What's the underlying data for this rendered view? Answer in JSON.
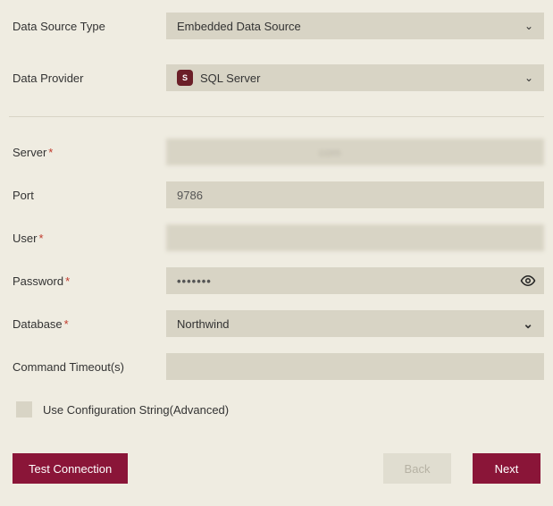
{
  "labels": {
    "dataSourceType": "Data Source Type",
    "dataProvider": "Data Provider",
    "server": "Server",
    "port": "Port",
    "user": "User",
    "password": "Password",
    "database": "Database",
    "commandTimeout": "Command Timeout(s)",
    "configString": "Use Configuration String(Advanced)"
  },
  "values": {
    "dataSourceType": "Embedded Data Source",
    "dataProvider": "SQL Server",
    "server": "                                            com",
    "port": "9786",
    "user": "",
    "password": "•••••••",
    "database": "Northwind",
    "commandTimeout": ""
  },
  "buttons": {
    "testConnection": "Test Connection",
    "back": "Back",
    "next": "Next"
  },
  "checkbox": {
    "configStringChecked": false
  }
}
